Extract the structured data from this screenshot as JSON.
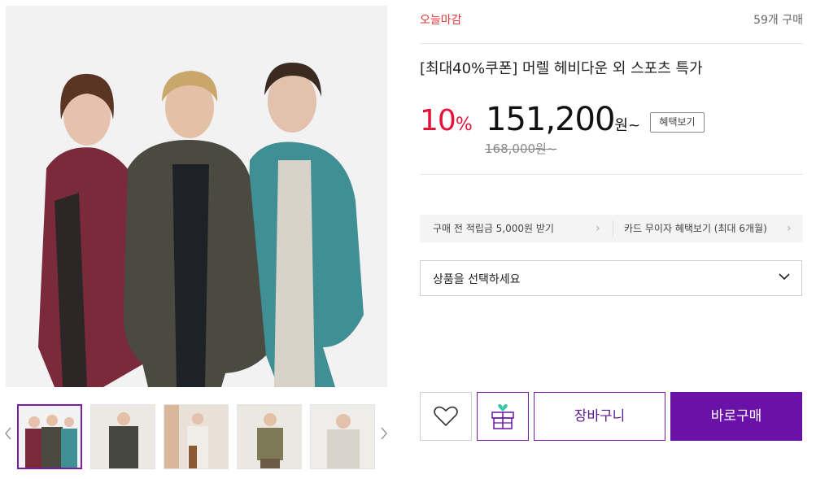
{
  "product": {
    "badge": "오늘마감",
    "sold_count": "59개 구매",
    "title": "[최대40%쿠폰] 머렐 헤비다운 외 스포츠 특가",
    "discount_value": "10",
    "discount_unit": "%",
    "sale_price": "151,200",
    "sale_price_unit": "원~",
    "benefit_button": "혜택보기",
    "original_price": "168,000원~"
  },
  "benefits": {
    "left": "구매 전 적립금 5,000원 받기",
    "right": "카드 무이자 혜택보기 (최대 6개월)"
  },
  "option_select": {
    "placeholder": "상품을 선택하세요"
  },
  "actions": {
    "cart": "장바구니",
    "buy": "바로구매"
  },
  "icons": {
    "wish": "heart-icon",
    "gift": "gift-icon",
    "dropdown": "chevron-down-icon",
    "prev": "chevron-left-icon",
    "next": "chevron-right-icon"
  },
  "colors": {
    "accent_purple": "#6a12a8",
    "discount_red": "#e5113b",
    "badge_red": "#e5393b",
    "gift_heart_teal": "#3fc6a8"
  }
}
